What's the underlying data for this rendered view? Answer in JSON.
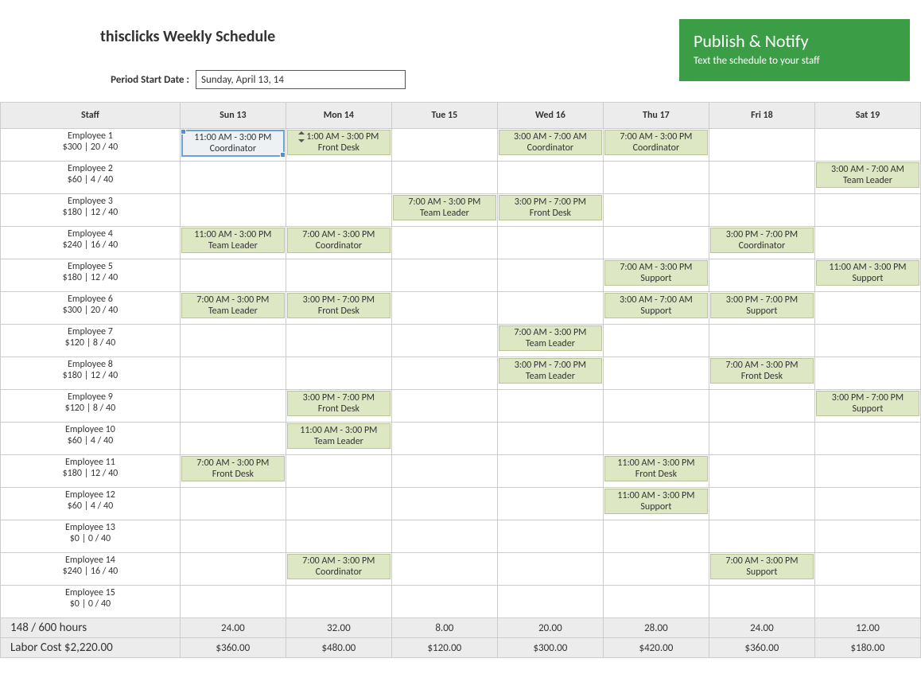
{
  "title": "thisclicks Weekly Schedule",
  "period_label": "Period Start Date :",
  "period_value": "Sunday, April 13, 14",
  "publish": {
    "heading": "Publish & Notify",
    "sub": "Text the schedule to your staff"
  },
  "headers": {
    "staff": "Staff",
    "days": [
      "Sun 13",
      "Mon 14",
      "Tue 15",
      "Wed 16",
      "Thu 17",
      "Fri 18",
      "Sat 19"
    ]
  },
  "rows": [
    {
      "name": "Employee 1",
      "stats": "$300 | 20 / 40",
      "shifts": [
        {
          "time": "11:00 AM - 3:00 PM",
          "role": "Coordinator",
          "selected": true
        },
        {
          "time": "1:00 AM - 3:00 PM",
          "role": "Front Desk",
          "stepper": true
        },
        null,
        {
          "time": "3:00 AM - 7:00 AM",
          "role": "Coordinator"
        },
        {
          "time": "7:00 AM - 3:00 PM",
          "role": "Coordinator"
        },
        null,
        null
      ]
    },
    {
      "name": "Employee 2",
      "stats": "$60 | 4 / 40",
      "shifts": [
        null,
        null,
        null,
        null,
        null,
        null,
        {
          "time": "3:00 AM - 7:00 AM",
          "role": "Team Leader"
        }
      ]
    },
    {
      "name": "Employee 3",
      "stats": "$180 | 12 / 40",
      "shifts": [
        null,
        null,
        {
          "time": "7:00 AM - 3:00 PM",
          "role": "Team Leader"
        },
        {
          "time": "3:00 PM - 7:00 PM",
          "role": "Front Desk"
        },
        null,
        null,
        null
      ]
    },
    {
      "name": "Employee 4",
      "stats": "$240 | 16 / 40",
      "shifts": [
        {
          "time": "11:00 AM - 3:00 PM",
          "role": "Team Leader"
        },
        {
          "time": "7:00 AM - 3:00 PM",
          "role": "Coordinator"
        },
        null,
        null,
        null,
        {
          "time": "3:00 PM - 7:00 PM",
          "role": "Coordinator"
        },
        null
      ]
    },
    {
      "name": "Employee 5",
      "stats": "$180 | 12 / 40",
      "shifts": [
        null,
        null,
        null,
        null,
        {
          "time": "7:00 AM - 3:00 PM",
          "role": "Support"
        },
        null,
        {
          "time": "11:00 AM - 3:00 PM",
          "role": "Support"
        }
      ]
    },
    {
      "name": "Employee 6",
      "stats": "$300 | 20 / 40",
      "shifts": [
        {
          "time": "7:00 AM - 3:00 PM",
          "role": "Team Leader"
        },
        {
          "time": "3:00 PM - 7:00 PM",
          "role": "Front Desk"
        },
        null,
        null,
        {
          "time": "3:00 AM - 7:00 AM",
          "role": "Support"
        },
        {
          "time": "3:00 PM - 7:00 PM",
          "role": "Support"
        },
        null
      ]
    },
    {
      "name": "Employee 7",
      "stats": "$120 | 8 / 40",
      "shifts": [
        null,
        null,
        null,
        {
          "time": "7:00 AM - 3:00 PM",
          "role": "Team Leader"
        },
        null,
        null,
        null
      ]
    },
    {
      "name": "Employee 8",
      "stats": "$180 | 12 / 40",
      "shifts": [
        null,
        null,
        null,
        {
          "time": "3:00 PM - 7:00 PM",
          "role": "Team Leader"
        },
        null,
        {
          "time": "7:00 AM - 3:00 PM",
          "role": "Front Desk"
        },
        null
      ]
    },
    {
      "name": "Employee 9",
      "stats": "$120 | 8 / 40",
      "shifts": [
        null,
        {
          "time": "3:00 PM - 7:00 PM",
          "role": "Front Desk"
        },
        null,
        null,
        null,
        null,
        {
          "time": "3:00 PM - 7:00 PM",
          "role": "Support"
        }
      ]
    },
    {
      "name": "Employee 10",
      "stats": "$60 | 4 / 40",
      "shifts": [
        null,
        {
          "time": "11:00 AM - 3:00 PM",
          "role": "Team Leader"
        },
        null,
        null,
        null,
        null,
        null
      ]
    },
    {
      "name": "Employee 11",
      "stats": "$180 | 12 / 40",
      "shifts": [
        {
          "time": "7:00 AM - 3:00 PM",
          "role": "Front Desk"
        },
        null,
        null,
        null,
        {
          "time": "11:00 AM - 3:00 PM",
          "role": "Front Desk"
        },
        null,
        null
      ]
    },
    {
      "name": "Employee 12",
      "stats": "$60 | 4 / 40",
      "shifts": [
        null,
        null,
        null,
        null,
        {
          "time": "11:00 AM - 3:00 PM",
          "role": "Support"
        },
        null,
        null
      ]
    },
    {
      "name": "Employee 13",
      "stats": "$0 | 0 / 40",
      "shifts": [
        null,
        null,
        null,
        null,
        null,
        null,
        null
      ]
    },
    {
      "name": "Employee 14",
      "stats": "$240 | 16 / 40",
      "shifts": [
        null,
        {
          "time": "7:00 AM - 3:00 PM",
          "role": "Coordinator"
        },
        null,
        null,
        null,
        {
          "time": "7:00 AM - 3:00 PM",
          "role": "Support"
        },
        null
      ]
    },
    {
      "name": "Employee 15",
      "stats": "$0 | 0 / 40",
      "shifts": [
        null,
        null,
        null,
        null,
        null,
        null,
        null
      ]
    }
  ],
  "totals": {
    "hours_label": "148 / 600 hours",
    "cost_label": "Labor Cost $2,220.00",
    "hours": [
      "24.00",
      "32.00",
      "8.00",
      "20.00",
      "28.00",
      "24.00",
      "12.00"
    ],
    "costs": [
      "$360.00",
      "$480.00",
      "$120.00",
      "$300.00",
      "$420.00",
      "$360.00",
      "$180.00"
    ]
  }
}
